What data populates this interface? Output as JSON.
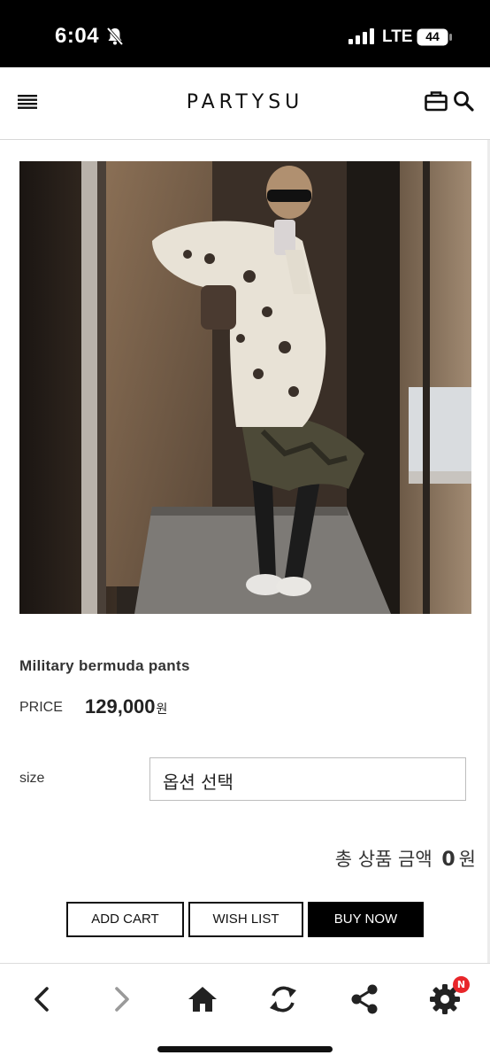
{
  "status_bar": {
    "time": "6:04",
    "network": "LTE",
    "battery": "44"
  },
  "header": {
    "brand": "PARTYSU",
    "icons": [
      "menu-icon",
      "bag-icon",
      "search-icon"
    ]
  },
  "product": {
    "name": "Military bermuda pants",
    "price_label": "PRICE",
    "price_value": "129,000",
    "price_unit": "원",
    "image_icon": "product-photo"
  },
  "options": {
    "size_label": "size",
    "size_placeholder": "옵션 선택"
  },
  "total": {
    "label": "총 상품 금액",
    "amount": "0",
    "unit": "원"
  },
  "actions": {
    "add_cart": "ADD CART",
    "wish_list": "WISH LIST",
    "buy_now": "BUY NOW"
  },
  "toolbar": {
    "icons": [
      "back-icon",
      "forward-icon",
      "home-icon",
      "refresh-icon",
      "share-icon",
      "settings-icon"
    ],
    "badge": "N",
    "colors": {
      "badge": "#e8262a",
      "forward_disabled": "#9a9a9a"
    }
  }
}
